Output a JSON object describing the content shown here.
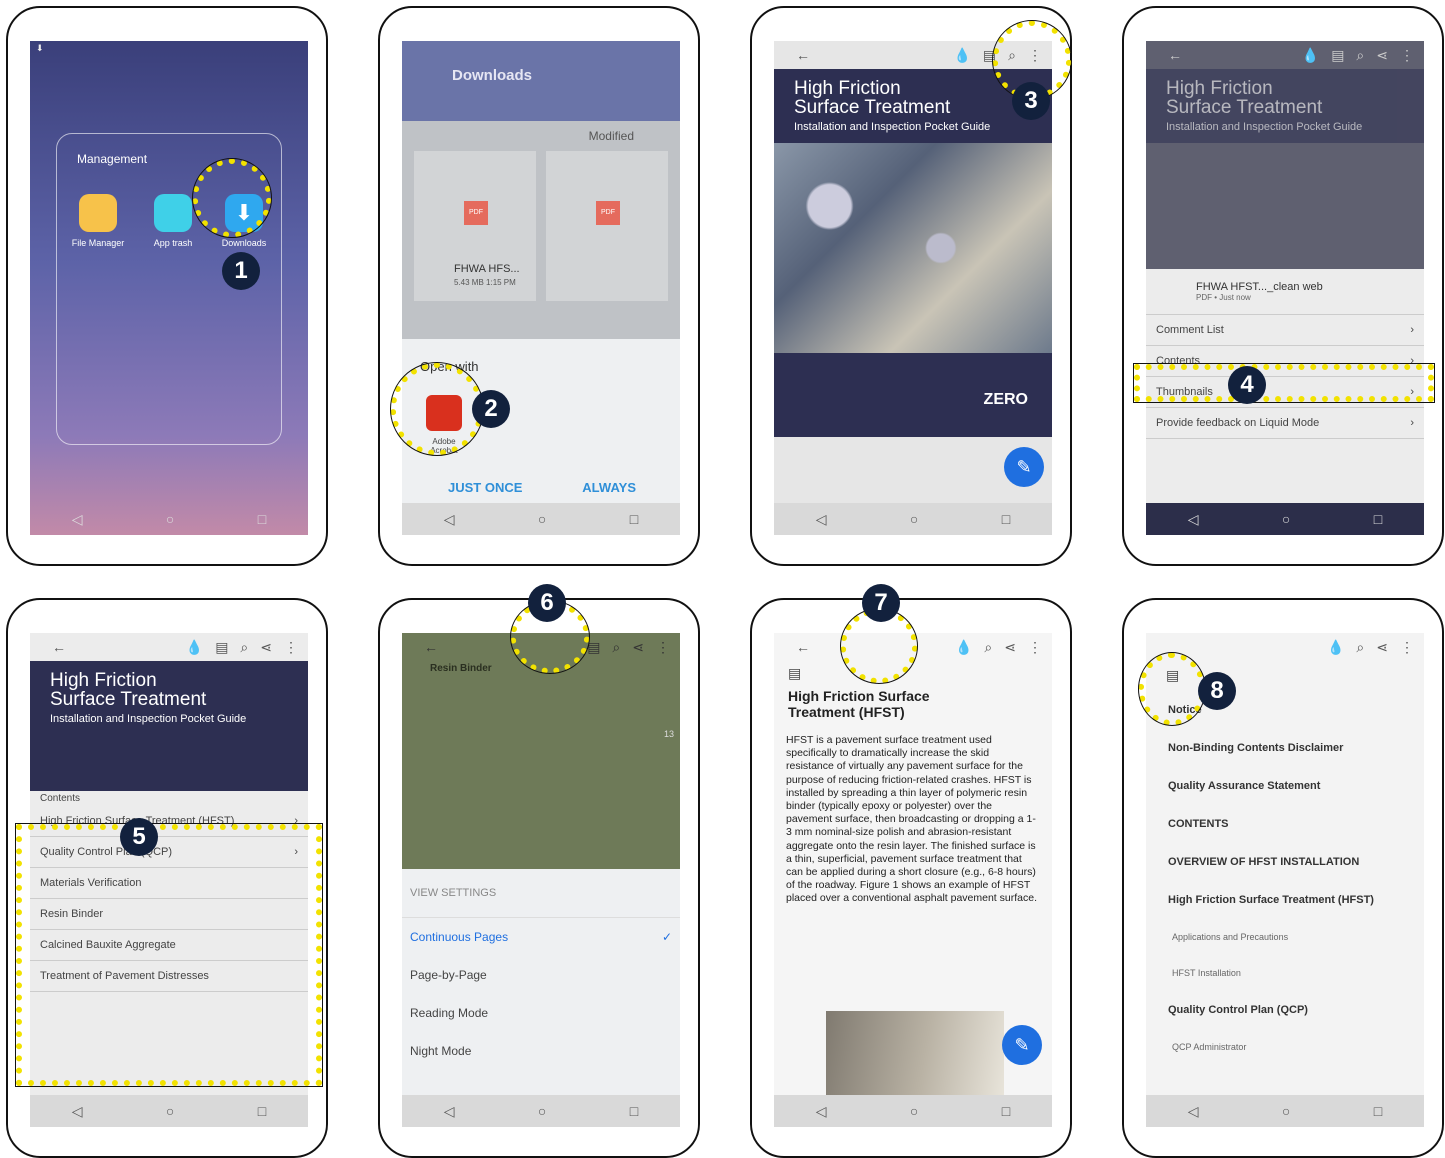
{
  "steps": [
    "1",
    "2",
    "3",
    "4",
    "5",
    "6",
    "7",
    "8"
  ],
  "p1": {
    "folder": "Management",
    "apps": [
      "File Manager",
      "App trash",
      "Downloads"
    ]
  },
  "p2": {
    "title": "Downloads",
    "sort": "Modified",
    "file1": "FHWA HFS...",
    "file_meta": "5.43 MB 1:15 PM",
    "open_with": "Open with",
    "app": "Adobe Acrobat",
    "just_once": "JUST ONCE",
    "always": "ALWAYS",
    "pdf": "PDF"
  },
  "p3": {
    "title1": "High Friction",
    "title2": "Surface Treatment",
    "subtitle": "Installation and Inspection Pocket Guide",
    "zero": "ZERO"
  },
  "p4": {
    "file": "FHWA HFST..._clean web",
    "meta": "PDF • Just now",
    "items": [
      "Comment List",
      "Contents",
      "Thumbnails",
      "Provide feedback on Liquid Mode"
    ]
  },
  "p5": {
    "heading": "Contents",
    "items": [
      "High Friction Surface Treatment (HFST)",
      "Quality Control Plan (QCP)",
      "Materials Verification",
      "Resin Binder",
      "Calcined Bauxite Aggregate",
      "Treatment of Pavement Distresses"
    ]
  },
  "p6": {
    "section": "Resin Binder",
    "settings": "VIEW SETTINGS",
    "options": [
      "Continuous Pages",
      "Page-by-Page",
      "Reading Mode",
      "Night Mode"
    ],
    "page": "13"
  },
  "p7": {
    "title": "High Friction Surface Treatment (HFST)",
    "body": "HFST is a pavement surface treatment used specifically to dramatically increase the skid resistance of virtually any pavement surface for the purpose of reducing friction-related crashes. HFST is installed by spreading a thin layer of polymeric resin binder (typically epoxy or polyester) over the pavement surface, then broadcasting or dropping a 1-3 mm nominal-size polish and abrasion-resistant aggregate onto the resin layer. The finished surface is a thin, superficial, pavement surface treatment that can be applied during a short closure (e.g., 6-8 hours) of the roadway. Figure 1 shows an example of HFST placed over a conventional asphalt pavement surface."
  },
  "p8": {
    "items": [
      "Notice",
      "Non-Binding Contents Disclaimer",
      "Quality Assurance Statement",
      "CONTENTS",
      "OVERVIEW OF HFST INSTALLATION",
      "High Friction Surface Treatment (HFST)"
    ],
    "subs": [
      "Applications and Precautions",
      "HFST Installation"
    ],
    "more": "Quality Control Plan (QCP)",
    "last": "QCP Administrator"
  }
}
